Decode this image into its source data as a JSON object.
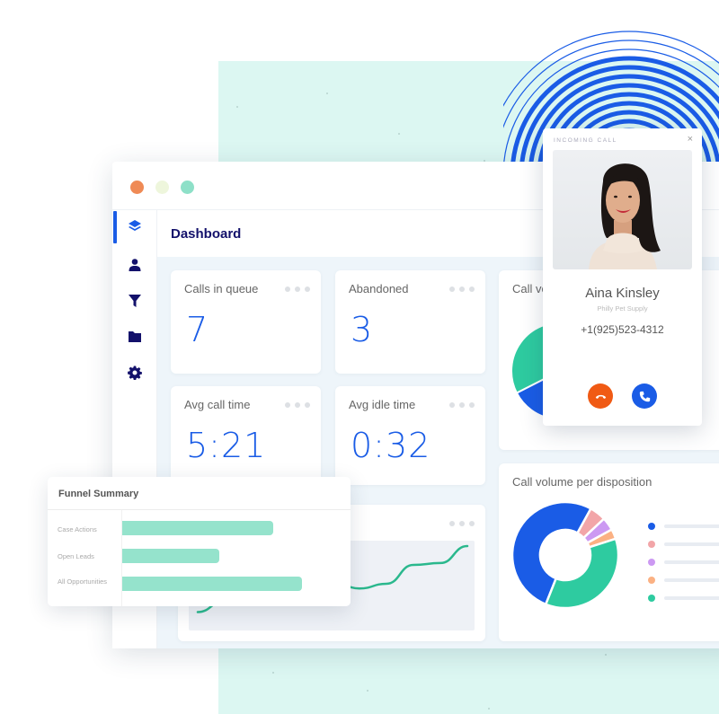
{
  "window": {
    "traffic_lights": [
      {
        "name": "close",
        "color": "#ef8a55"
      },
      {
        "name": "minimize",
        "color": "#eef6dc"
      },
      {
        "name": "maximize",
        "color": "#8ee0c8"
      }
    ]
  },
  "sidebar": {
    "items": [
      {
        "icon": "layers-icon",
        "active": true
      },
      {
        "icon": "user-icon",
        "active": false
      },
      {
        "icon": "filter-icon",
        "active": false
      },
      {
        "icon": "folder-icon",
        "active": false
      },
      {
        "icon": "gear-icon",
        "active": false
      }
    ]
  },
  "header": {
    "title": "Dashboard"
  },
  "cards": {
    "calls_in_queue": {
      "title": "Calls in queue",
      "value": "7"
    },
    "abandoned": {
      "title": "Abandoned",
      "value": "3"
    },
    "avg_call_time": {
      "title": "Avg call time",
      "value": "5:21"
    },
    "avg_idle_time": {
      "title": "Avg idle time",
      "value": "0:32"
    },
    "call_volume": {
      "title": "Call volume"
    },
    "call_volume_per_disposition": {
      "title": "Call volume per disposition"
    }
  },
  "funnel": {
    "title": "Funnel Summary",
    "rows": [
      {
        "label": "Case Actions",
        "fraction": 0.67
      },
      {
        "label": "Open Leads",
        "fraction": 0.43
      },
      {
        "label": "All Opportunities",
        "fraction": 0.8
      }
    ]
  },
  "incoming_call": {
    "label": "INCOMING CALL",
    "close": "×",
    "name": "Aina Kinsley",
    "company": "Philly Pet Supply",
    "phone": "+1(925)523-4312",
    "decline_color": "#f05a14",
    "accept_color": "#1a5ce6"
  },
  "chart_data": [
    {
      "type": "pie",
      "title": "Call volume per disposition",
      "donut": true,
      "values": [
        52,
        5,
        4,
        3,
        36
      ],
      "colors": [
        "#1a5ce6",
        "#f2a5a8",
        "#cc99f2",
        "#fbb183",
        "#2ecba0"
      ],
      "legend": "right"
    },
    {
      "type": "pie",
      "title": "Call volume",
      "values": [
        65,
        35
      ],
      "colors": [
        "#1a5ce6",
        "#2ecba0"
      ]
    },
    {
      "type": "line",
      "title": "",
      "values": [
        10,
        22,
        48,
        55,
        52,
        42,
        35,
        40,
        60,
        62,
        80
      ],
      "color": "#2ab88d"
    }
  ]
}
